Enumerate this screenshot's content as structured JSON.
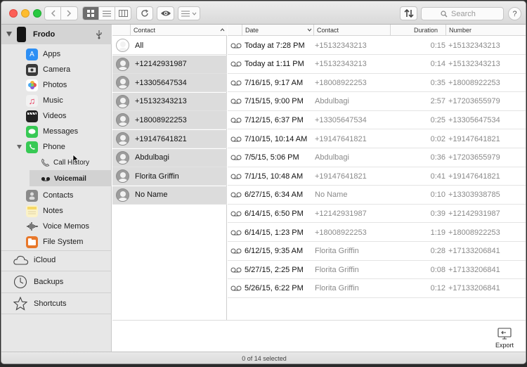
{
  "device": {
    "name": "Frodo"
  },
  "toolbar": {
    "search_placeholder": "Search",
    "help_label": "?"
  },
  "sidebar": {
    "items": [
      {
        "label": "Apps",
        "icon": "appstore-icon",
        "color": "#2d8ff4"
      },
      {
        "label": "Camera",
        "icon": "camera-icon",
        "color": "#3a3a3a"
      },
      {
        "label": "Photos",
        "icon": "photos-icon",
        "color": "#f4b23a"
      },
      {
        "label": "Music",
        "icon": "music-icon",
        "color": "#f2f2f2"
      },
      {
        "label": "Videos",
        "icon": "videos-icon",
        "color": "#222222"
      },
      {
        "label": "Messages",
        "icon": "messages-icon",
        "color": "#37c954"
      },
      {
        "label": "Phone",
        "icon": "phone-icon",
        "color": "#37c954"
      },
      {
        "label": "Call History",
        "icon": "phone-handset-icon"
      },
      {
        "label": "Voicemail",
        "icon": "voicemail-icon"
      },
      {
        "label": "Contacts",
        "icon": "contacts-icon",
        "color": "#7d7d7d"
      },
      {
        "label": "Notes",
        "icon": "notes-icon",
        "color": "#f6d867"
      },
      {
        "label": "Voice Memos",
        "icon": "voice-memos-icon"
      },
      {
        "label": "File System",
        "icon": "file-system-icon",
        "color": "#e8782b"
      }
    ],
    "sections": [
      {
        "label": "iCloud",
        "icon": "cloud-icon"
      },
      {
        "label": "Backups",
        "icon": "clock-icon"
      },
      {
        "label": "Shortcuts",
        "icon": "star-icon"
      }
    ]
  },
  "contacts_panel": {
    "header": "Contact",
    "rows": [
      "All",
      "+12142931987",
      "+13305647534",
      "+15132343213",
      "+18008922253",
      "+19147641821",
      "Abdulbagi",
      "Florita Griffin",
      "No Name"
    ]
  },
  "table": {
    "headers": {
      "date": "Date",
      "contact": "Contact",
      "duration": "Duration",
      "number": "Number"
    },
    "rows": [
      {
        "date": "Today at 7:28 PM",
        "contact": "+15132343213",
        "duration": "0:15",
        "number": "+15132343213"
      },
      {
        "date": "Today at 1:11 PM",
        "contact": "+15132343213",
        "duration": "0:14",
        "number": "+15132343213"
      },
      {
        "date": "7/16/15, 9:17 AM",
        "contact": "+18008922253",
        "duration": "0:35",
        "number": "+18008922253"
      },
      {
        "date": "7/15/15, 9:00 PM",
        "contact": "Abdulbagi",
        "duration": "2:57",
        "number": "+17203655979"
      },
      {
        "date": "7/12/15, 6:37 PM",
        "contact": "+13305647534",
        "duration": "0:25",
        "number": "+13305647534"
      },
      {
        "date": "7/10/15, 10:14 AM",
        "contact": "+19147641821",
        "duration": "0:02",
        "number": "+19147641821"
      },
      {
        "date": "7/5/15, 5:06 PM",
        "contact": "Abdulbagi",
        "duration": "0:36",
        "number": "+17203655979"
      },
      {
        "date": "7/1/15, 10:48 AM",
        "contact": "+19147641821",
        "duration": "0:41",
        "number": "+19147641821"
      },
      {
        "date": "6/27/15, 6:34 AM",
        "contact": "No Name",
        "duration": "0:10",
        "number": "+13303938785"
      },
      {
        "date": "6/14/15, 6:50 PM",
        "contact": "+12142931987",
        "duration": "0:39",
        "number": "+12142931987"
      },
      {
        "date": "6/14/15, 1:23 PM",
        "contact": "+18008922253",
        "duration": "1:19",
        "number": "+18008922253"
      },
      {
        "date": "6/12/15, 9:35 AM",
        "contact": "Florita Griffin",
        "duration": "0:28",
        "number": "+17133206841"
      },
      {
        "date": "5/27/15, 2:25 PM",
        "contact": "Florita Griffin",
        "duration": "0:08",
        "number": "+17133206841"
      },
      {
        "date": "5/26/15, 6:22 PM",
        "contact": "Florita Griffin",
        "duration": "0:12",
        "number": "+17133206841"
      }
    ]
  },
  "export_label": "Export",
  "status": "0 of 14 selected"
}
